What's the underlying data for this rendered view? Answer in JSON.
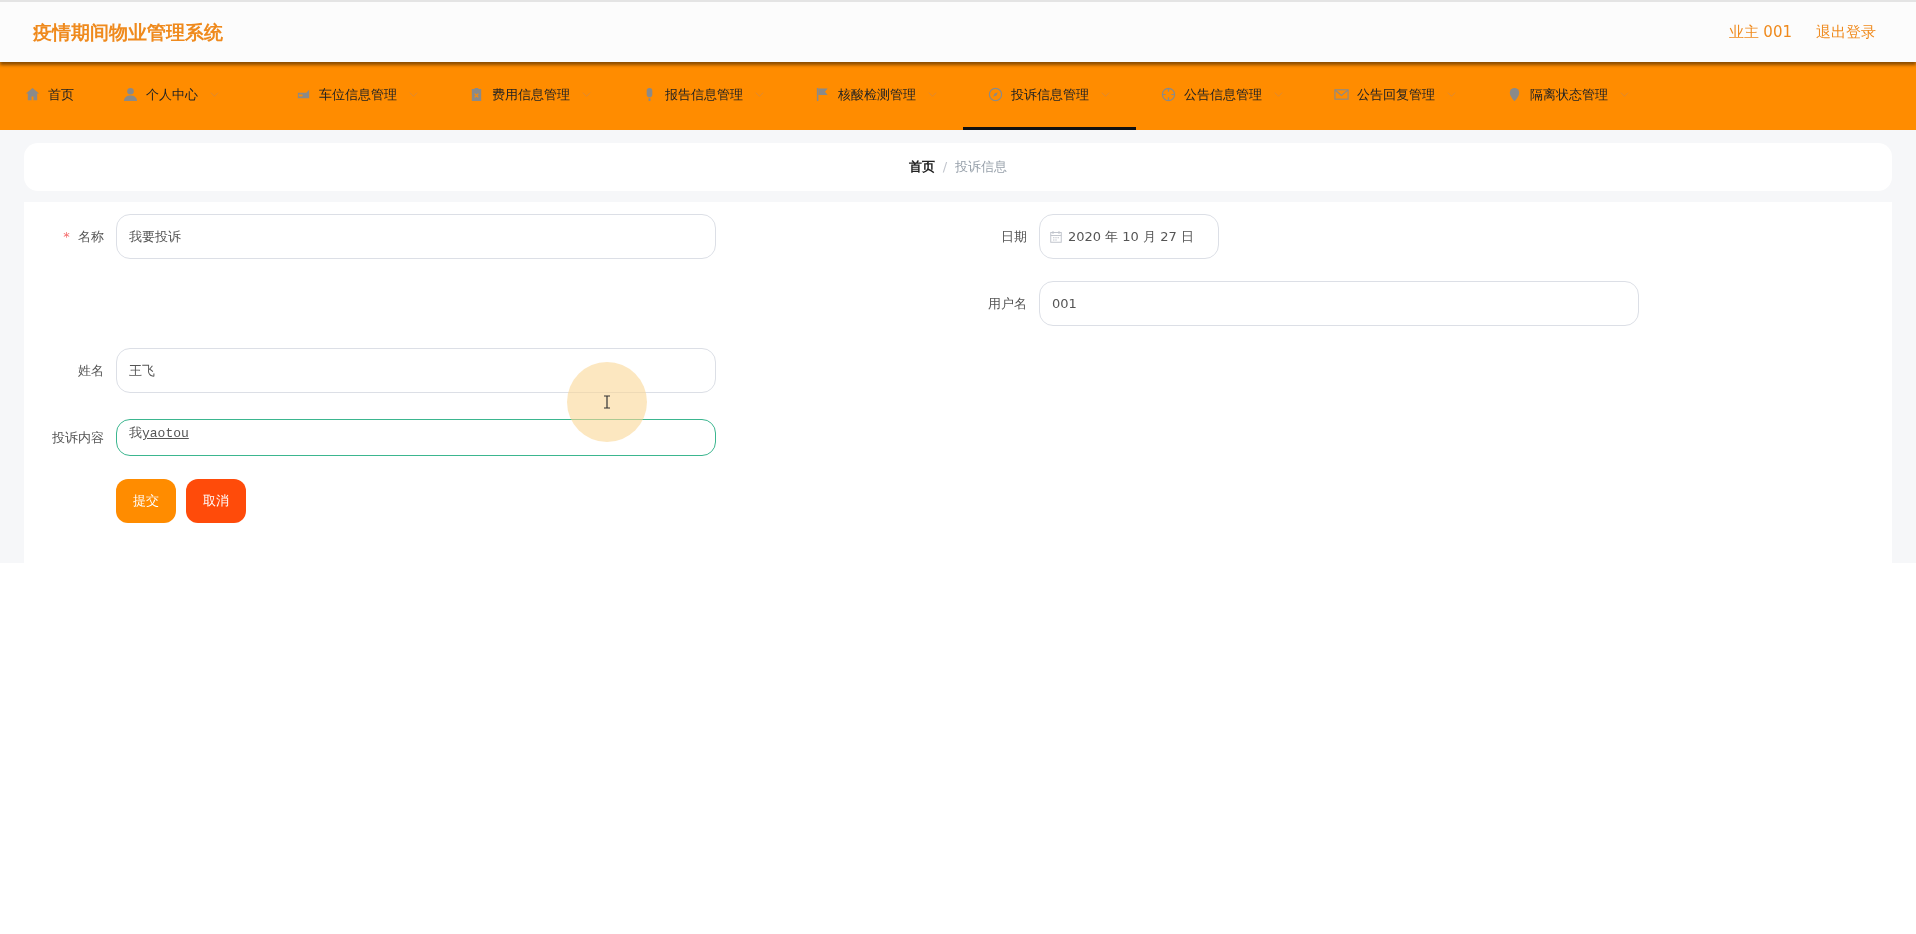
{
  "header": {
    "title": "疫情期间物业管理系统",
    "user": "业主 001",
    "logout": "退出登录"
  },
  "nav": [
    {
      "label": "首页",
      "has_menu": false,
      "selected": false
    },
    {
      "label": "个人中心",
      "has_menu": true,
      "selected": false
    },
    {
      "label": "车位信息管理",
      "has_menu": true,
      "selected": false
    },
    {
      "label": "费用信息管理",
      "has_menu": true,
      "selected": false
    },
    {
      "label": "报告信息管理",
      "has_menu": true,
      "selected": false
    },
    {
      "label": "核酸检测管理",
      "has_menu": true,
      "selected": false
    },
    {
      "label": "投诉信息管理",
      "has_menu": true,
      "selected": true
    },
    {
      "label": "公告信息管理",
      "has_menu": true,
      "selected": false
    },
    {
      "label": "公告回复管理",
      "has_menu": true,
      "selected": false
    },
    {
      "label": "隔离状态管理",
      "has_menu": true,
      "selected": false
    }
  ],
  "breadcrumb": {
    "items": [
      "首页",
      "投诉信息"
    ],
    "separator": "/"
  },
  "form": {
    "required_mark": "*",
    "rows": [
      {
        "left": {
          "label": "名称",
          "kind": "text",
          "required": true,
          "value": "我要投诉",
          "focused": false
        },
        "right": {
          "label": "日期",
          "kind": "date",
          "required": false,
          "value": "2020 年 10 月 27 日",
          "focused": false
        }
      },
      {
        "right": {
          "label": "用户名",
          "kind": "text",
          "required": false,
          "value": "001",
          "focused": false
        }
      },
      {
        "left": {
          "label": "姓名",
          "kind": "text",
          "required": false,
          "value": "王飞",
          "focused": false
        }
      },
      {
        "left": {
          "label": "投诉内容",
          "kind": "textarea",
          "required": false,
          "value": "我",
          "composition": "yaotou",
          "focused": true
        }
      }
    ],
    "buttons": [
      {
        "label": "提交",
        "kind": "primary"
      },
      {
        "label": "取消",
        "kind": "danger"
      }
    ]
  }
}
